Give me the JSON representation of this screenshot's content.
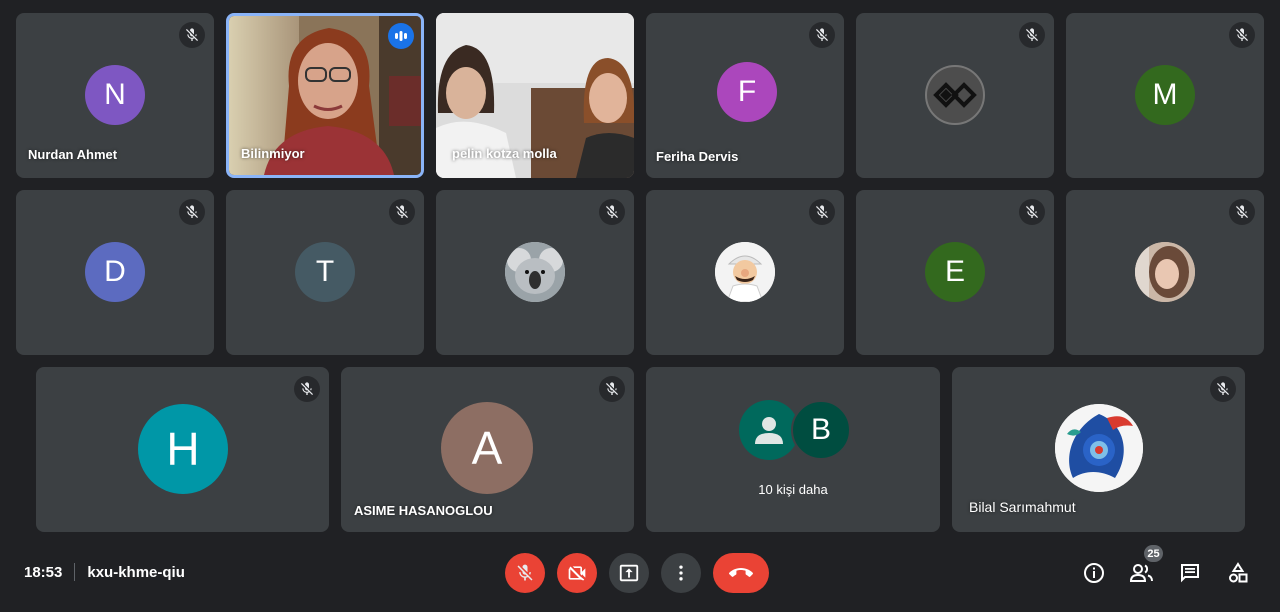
{
  "participants": {
    "nurdan": {
      "name": "Nurdan Ahmet",
      "initial": "N",
      "color": "#7e57c2"
    },
    "bilinmiyor": {
      "name": "Bilinmiyor"
    },
    "pelin": {
      "name": "pelin kotza molla"
    },
    "feriha": {
      "name": "Feriha Dervis",
      "initial": "F",
      "color": "#ab47bc"
    },
    "logo_user": {
      "name": ""
    },
    "m_user": {
      "initial": "M",
      "color": "#33691e"
    },
    "d_user": {
      "initial": "D",
      "color": "#5c6bc0"
    },
    "t_user": {
      "initial": "T",
      "color": "#455a64"
    },
    "koala_user": {
      "name": ""
    },
    "mario_user": {
      "name": ""
    },
    "e_user": {
      "initial": "E",
      "color": "#33691e"
    },
    "photo_user": {
      "name": ""
    },
    "h_user": {
      "initial": "H",
      "color": "#0097a7"
    },
    "asime": {
      "name": "ASIME HASANOGLOU",
      "initial": "A",
      "color": "#8d6e63"
    },
    "more": {
      "label": "10 kişi daha",
      "b_initial": "B",
      "b_color": "#004d40",
      "person_color": "#00695c"
    },
    "bilal": {
      "name": "Bilal Sarımahmut"
    }
  },
  "meeting": {
    "time": "18:53",
    "code": "kxu-khme-qiu",
    "people_count": "25"
  },
  "colors": {
    "tile": "#3c4043",
    "background": "#202124",
    "accent_blue": "#8ab4f8",
    "danger_red": "#ea4335"
  },
  "icons": {
    "tile_mute": "mic-off-icon",
    "speaking": "audio-bars-icon",
    "mic": "mic-off-icon",
    "camera": "camera-off-icon",
    "present": "present-screen-icon",
    "more": "more-vert-icon",
    "leave": "end-call-icon",
    "info": "info-icon",
    "people": "people-icon",
    "chat": "chat-icon",
    "activities": "activities-icon"
  }
}
